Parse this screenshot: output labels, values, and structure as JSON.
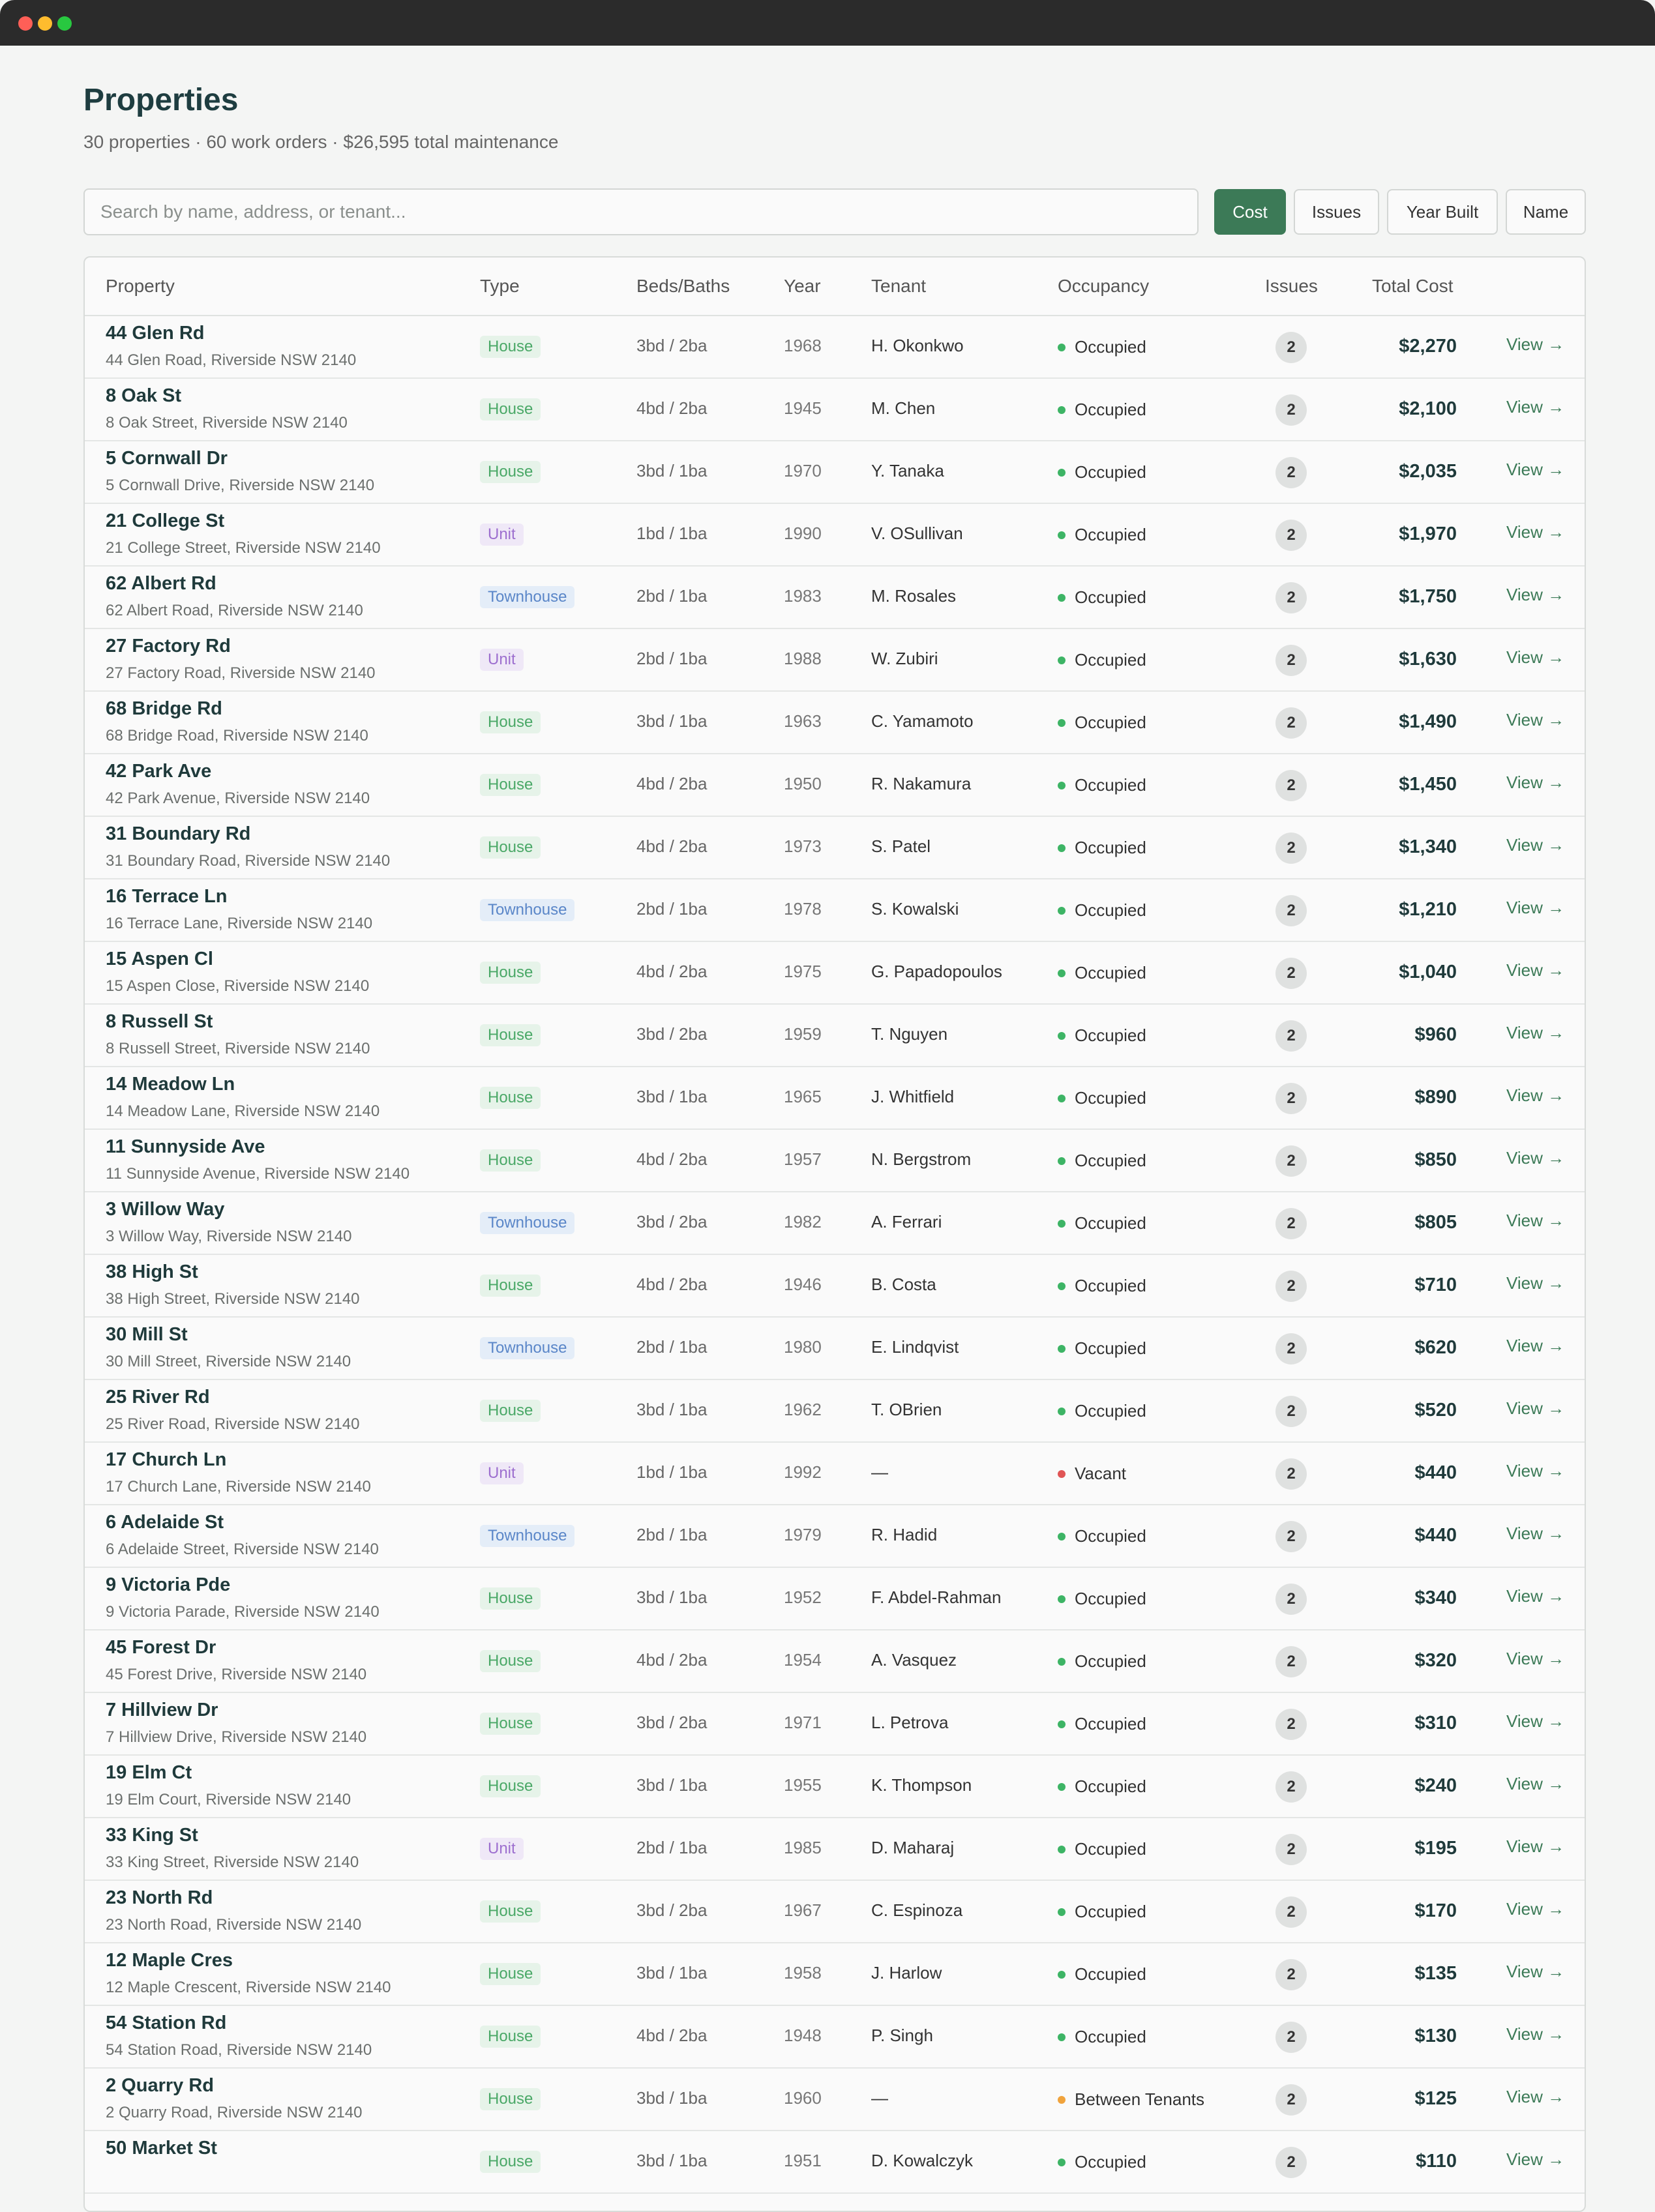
{
  "header": {
    "title": "Properties",
    "subtitle": "30 properties · 60 work orders · $26,595 total maintenance"
  },
  "search": {
    "placeholder": "Search by name, address, or tenant...",
    "value": ""
  },
  "sort_buttons": [
    {
      "label": "Cost",
      "active": true
    },
    {
      "label": "Issues",
      "active": false
    },
    {
      "label": "Year Built",
      "active": false
    },
    {
      "label": "Name",
      "active": false
    }
  ],
  "table": {
    "columns": [
      "Property",
      "Type",
      "Beds/Baths",
      "Year",
      "Tenant",
      "Occupancy",
      "Issues",
      "Total Cost"
    ],
    "view_label": "View →",
    "rows": [
      {
        "name": "44 Glen Rd",
        "address": "44 Glen Road, Riverside NSW 2140",
        "type": "House",
        "beds": "3bd / 2ba",
        "year": "1968",
        "tenant": "H. Okonkwo",
        "occupancy": "Occupied",
        "issues": "2",
        "cost": "$2,270"
      },
      {
        "name": "8 Oak St",
        "address": "8 Oak Street, Riverside NSW 2140",
        "type": "House",
        "beds": "4bd / 2ba",
        "year": "1945",
        "tenant": "M. Chen",
        "occupancy": "Occupied",
        "issues": "2",
        "cost": "$2,100"
      },
      {
        "name": "5 Cornwall Dr",
        "address": "5 Cornwall Drive, Riverside NSW 2140",
        "type": "House",
        "beds": "3bd / 1ba",
        "year": "1970",
        "tenant": "Y. Tanaka",
        "occupancy": "Occupied",
        "issues": "2",
        "cost": "$2,035"
      },
      {
        "name": "21 College St",
        "address": "21 College Street, Riverside NSW 2140",
        "type": "Unit",
        "beds": "1bd / 1ba",
        "year": "1990",
        "tenant": "V. OSullivan",
        "occupancy": "Occupied",
        "issues": "2",
        "cost": "$1,970"
      },
      {
        "name": "62 Albert Rd",
        "address": "62 Albert Road, Riverside NSW 2140",
        "type": "Townhouse",
        "beds": "2bd / 1ba",
        "year": "1983",
        "tenant": "M. Rosales",
        "occupancy": "Occupied",
        "issues": "2",
        "cost": "$1,750"
      },
      {
        "name": "27 Factory Rd",
        "address": "27 Factory Road, Riverside NSW 2140",
        "type": "Unit",
        "beds": "2bd / 1ba",
        "year": "1988",
        "tenant": "W. Zubiri",
        "occupancy": "Occupied",
        "issues": "2",
        "cost": "$1,630"
      },
      {
        "name": "68 Bridge Rd",
        "address": "68 Bridge Road, Riverside NSW 2140",
        "type": "House",
        "beds": "3bd / 1ba",
        "year": "1963",
        "tenant": "C. Yamamoto",
        "occupancy": "Occupied",
        "issues": "2",
        "cost": "$1,490"
      },
      {
        "name": "42 Park Ave",
        "address": "42 Park Avenue, Riverside NSW 2140",
        "type": "House",
        "beds": "4bd / 2ba",
        "year": "1950",
        "tenant": "R. Nakamura",
        "occupancy": "Occupied",
        "issues": "2",
        "cost": "$1,450"
      },
      {
        "name": "31 Boundary Rd",
        "address": "31 Boundary Road, Riverside NSW 2140",
        "type": "House",
        "beds": "4bd / 2ba",
        "year": "1973",
        "tenant": "S. Patel",
        "occupancy": "Occupied",
        "issues": "2",
        "cost": "$1,340"
      },
      {
        "name": "16 Terrace Ln",
        "address": "16 Terrace Lane, Riverside NSW 2140",
        "type": "Townhouse",
        "beds": "2bd / 1ba",
        "year": "1978",
        "tenant": "S. Kowalski",
        "occupancy": "Occupied",
        "issues": "2",
        "cost": "$1,210"
      },
      {
        "name": "15 Aspen Cl",
        "address": "15 Aspen Close, Riverside NSW 2140",
        "type": "House",
        "beds": "4bd / 2ba",
        "year": "1975",
        "tenant": "G. Papadopoulos",
        "occupancy": "Occupied",
        "issues": "2",
        "cost": "$1,040"
      },
      {
        "name": "8 Russell St",
        "address": "8 Russell Street, Riverside NSW 2140",
        "type": "House",
        "beds": "3bd / 2ba",
        "year": "1959",
        "tenant": "T. Nguyen",
        "occupancy": "Occupied",
        "issues": "2",
        "cost": "$960"
      },
      {
        "name": "14 Meadow Ln",
        "address": "14 Meadow Lane, Riverside NSW 2140",
        "type": "House",
        "beds": "3bd / 1ba",
        "year": "1965",
        "tenant": "J. Whitfield",
        "occupancy": "Occupied",
        "issues": "2",
        "cost": "$890"
      },
      {
        "name": "11 Sunnyside Ave",
        "address": "11 Sunnyside Avenue, Riverside NSW 2140",
        "type": "House",
        "beds": "4bd / 2ba",
        "year": "1957",
        "tenant": "N. Bergstrom",
        "occupancy": "Occupied",
        "issues": "2",
        "cost": "$850"
      },
      {
        "name": "3 Willow Way",
        "address": "3 Willow Way, Riverside NSW 2140",
        "type": "Townhouse",
        "beds": "3bd / 2ba",
        "year": "1982",
        "tenant": "A. Ferrari",
        "occupancy": "Occupied",
        "issues": "2",
        "cost": "$805"
      },
      {
        "name": "38 High St",
        "address": "38 High Street, Riverside NSW 2140",
        "type": "House",
        "beds": "4bd / 2ba",
        "year": "1946",
        "tenant": "B. Costa",
        "occupancy": "Occupied",
        "issues": "2",
        "cost": "$710"
      },
      {
        "name": "30 Mill St",
        "address": "30 Mill Street, Riverside NSW 2140",
        "type": "Townhouse",
        "beds": "2bd / 1ba",
        "year": "1980",
        "tenant": "E. Lindqvist",
        "occupancy": "Occupied",
        "issues": "2",
        "cost": "$620"
      },
      {
        "name": "25 River Rd",
        "address": "25 River Road, Riverside NSW 2140",
        "type": "House",
        "beds": "3bd / 1ba",
        "year": "1962",
        "tenant": "T. OBrien",
        "occupancy": "Occupied",
        "issues": "2",
        "cost": "$520"
      },
      {
        "name": "17 Church Ln",
        "address": "17 Church Lane, Riverside NSW 2140",
        "type": "Unit",
        "beds": "1bd / 1ba",
        "year": "1992",
        "tenant": "—",
        "occupancy": "Vacant",
        "issues": "2",
        "cost": "$440"
      },
      {
        "name": "6 Adelaide St",
        "address": "6 Adelaide Street, Riverside NSW 2140",
        "type": "Townhouse",
        "beds": "2bd / 1ba",
        "year": "1979",
        "tenant": "R. Hadid",
        "occupancy": "Occupied",
        "issues": "2",
        "cost": "$440"
      },
      {
        "name": "9 Victoria Pde",
        "address": "9 Victoria Parade, Riverside NSW 2140",
        "type": "House",
        "beds": "3bd / 1ba",
        "year": "1952",
        "tenant": "F. Abdel-Rahman",
        "occupancy": "Occupied",
        "issues": "2",
        "cost": "$340"
      },
      {
        "name": "45 Forest Dr",
        "address": "45 Forest Drive, Riverside NSW 2140",
        "type": "House",
        "beds": "4bd / 2ba",
        "year": "1954",
        "tenant": "A. Vasquez",
        "occupancy": "Occupied",
        "issues": "2",
        "cost": "$320"
      },
      {
        "name": "7 Hillview Dr",
        "address": "7 Hillview Drive, Riverside NSW 2140",
        "type": "House",
        "beds": "3bd / 2ba",
        "year": "1971",
        "tenant": "L. Petrova",
        "occupancy": "Occupied",
        "issues": "2",
        "cost": "$310"
      },
      {
        "name": "19 Elm Ct",
        "address": "19 Elm Court, Riverside NSW 2140",
        "type": "House",
        "beds": "3bd / 1ba",
        "year": "1955",
        "tenant": "K. Thompson",
        "occupancy": "Occupied",
        "issues": "2",
        "cost": "$240"
      },
      {
        "name": "33 King St",
        "address": "33 King Street, Riverside NSW 2140",
        "type": "Unit",
        "beds": "2bd / 1ba",
        "year": "1985",
        "tenant": "D. Maharaj",
        "occupancy": "Occupied",
        "issues": "2",
        "cost": "$195"
      },
      {
        "name": "23 North Rd",
        "address": "23 North Road, Riverside NSW 2140",
        "type": "House",
        "beds": "3bd / 2ba",
        "year": "1967",
        "tenant": "C. Espinoza",
        "occupancy": "Occupied",
        "issues": "2",
        "cost": "$170"
      },
      {
        "name": "12 Maple Cres",
        "address": "12 Maple Crescent, Riverside NSW 2140",
        "type": "House",
        "beds": "3bd / 1ba",
        "year": "1958",
        "tenant": "J. Harlow",
        "occupancy": "Occupied",
        "issues": "2",
        "cost": "$135"
      },
      {
        "name": "54 Station Rd",
        "address": "54 Station Road, Riverside NSW 2140",
        "type": "House",
        "beds": "4bd / 2ba",
        "year": "1948",
        "tenant": "P. Singh",
        "occupancy": "Occupied",
        "issues": "2",
        "cost": "$130"
      },
      {
        "name": "2 Quarry Rd",
        "address": "2 Quarry Road, Riverside NSW 2140",
        "type": "House",
        "beds": "3bd / 1ba",
        "year": "1960",
        "tenant": "—",
        "occupancy": "Between Tenants",
        "issues": "2",
        "cost": "$125"
      },
      {
        "name": "50 Market St",
        "address": "",
        "type": "House",
        "beds": "3bd / 1ba",
        "year": "1951",
        "tenant": "D. Kowalczyk",
        "occupancy": "Occupied",
        "issues": "2",
        "cost": "$110"
      }
    ]
  },
  "colors": {
    "accent": "#3c7a57",
    "title": "#1e3d40",
    "occupied": "#3db465",
    "vacant": "#e05555",
    "between_tenants": "#f0a33c"
  }
}
